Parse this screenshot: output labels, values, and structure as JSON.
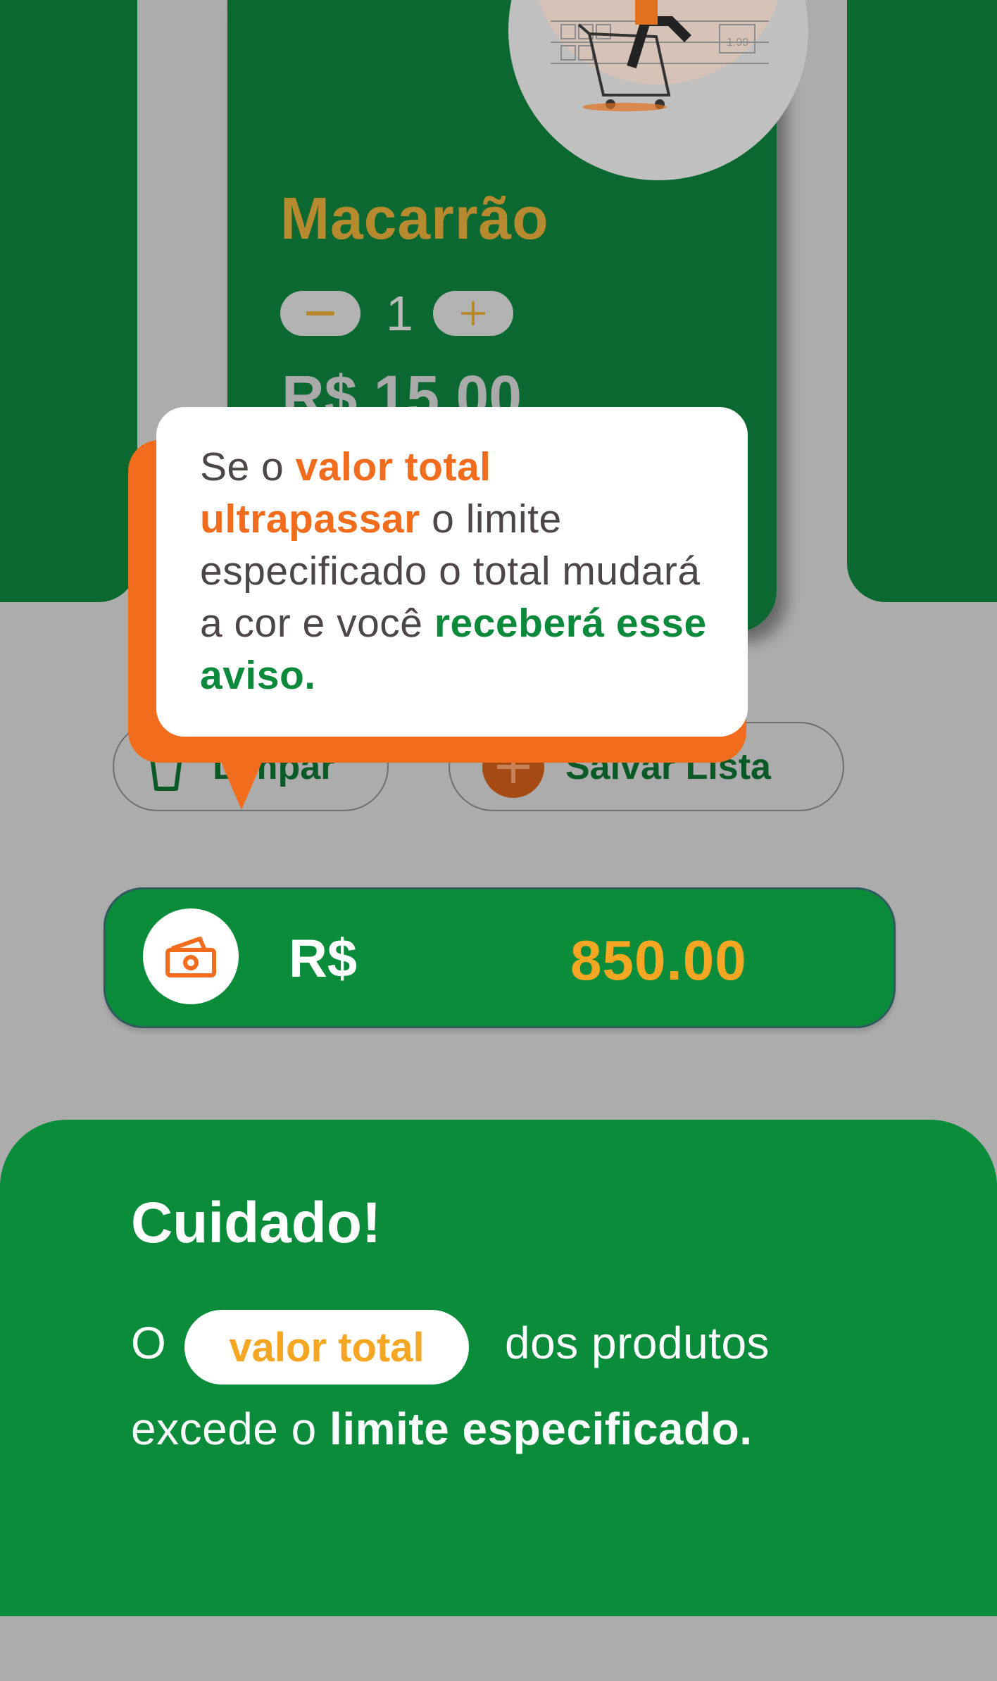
{
  "product": {
    "name": "Macarrão",
    "quantity": "1",
    "price": "R$ 15.00",
    "minus_symbol": "−",
    "plus_symbol": "+"
  },
  "actions": {
    "clear_label": "Limpar",
    "save_label": "Salvar Lista"
  },
  "tooltip": {
    "part1": "Se o ",
    "highlight1": "valor total ultrapassar",
    "part2": " o limite especificado o total mudará a cor e você ",
    "highlight2": "receberá esse aviso."
  },
  "total": {
    "currency": "R$",
    "value": "850.00"
  },
  "warning": {
    "title": "Cuidado!",
    "prefix": "O",
    "pill": "valor total",
    "rest": "dos produtos",
    "line2_normal": "excede o ",
    "line2_bold": "limite especificado."
  },
  "colors": {
    "dark_green": "#0a6830",
    "green": "#0b8c3b",
    "orange": "#f26c1d",
    "gold": "#f5a623",
    "overlay_gray": "#acacac"
  },
  "icons": {
    "money": "money-icon",
    "trash": "trash-icon",
    "add": "plus-circle-icon"
  }
}
